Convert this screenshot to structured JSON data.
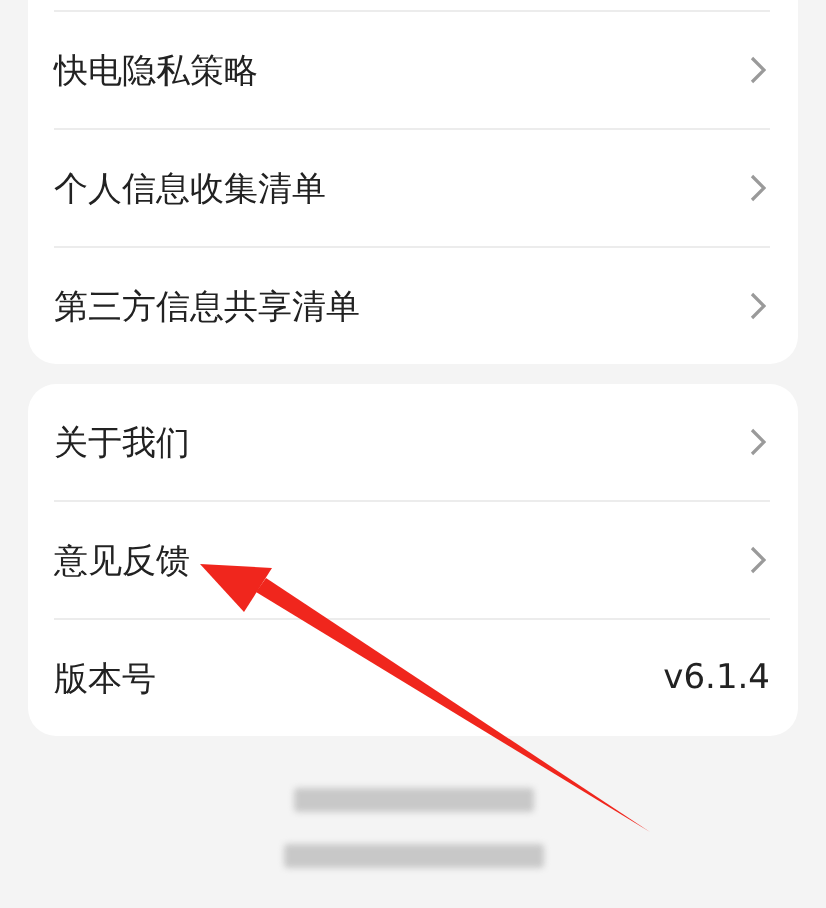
{
  "sections": [
    {
      "cut_top": true,
      "items": [
        {
          "kind": "link",
          "label": "快电隐私策略"
        },
        {
          "kind": "link",
          "label": "个人信息收集清单"
        },
        {
          "kind": "link",
          "label": "第三方信息共享清单"
        }
      ]
    },
    {
      "cut_top": false,
      "items": [
        {
          "kind": "link",
          "label": "关于我们"
        },
        {
          "kind": "link",
          "label": "意见反馈"
        },
        {
          "kind": "value",
          "label": "版本号",
          "value": "v6.1.4"
        }
      ]
    }
  ]
}
